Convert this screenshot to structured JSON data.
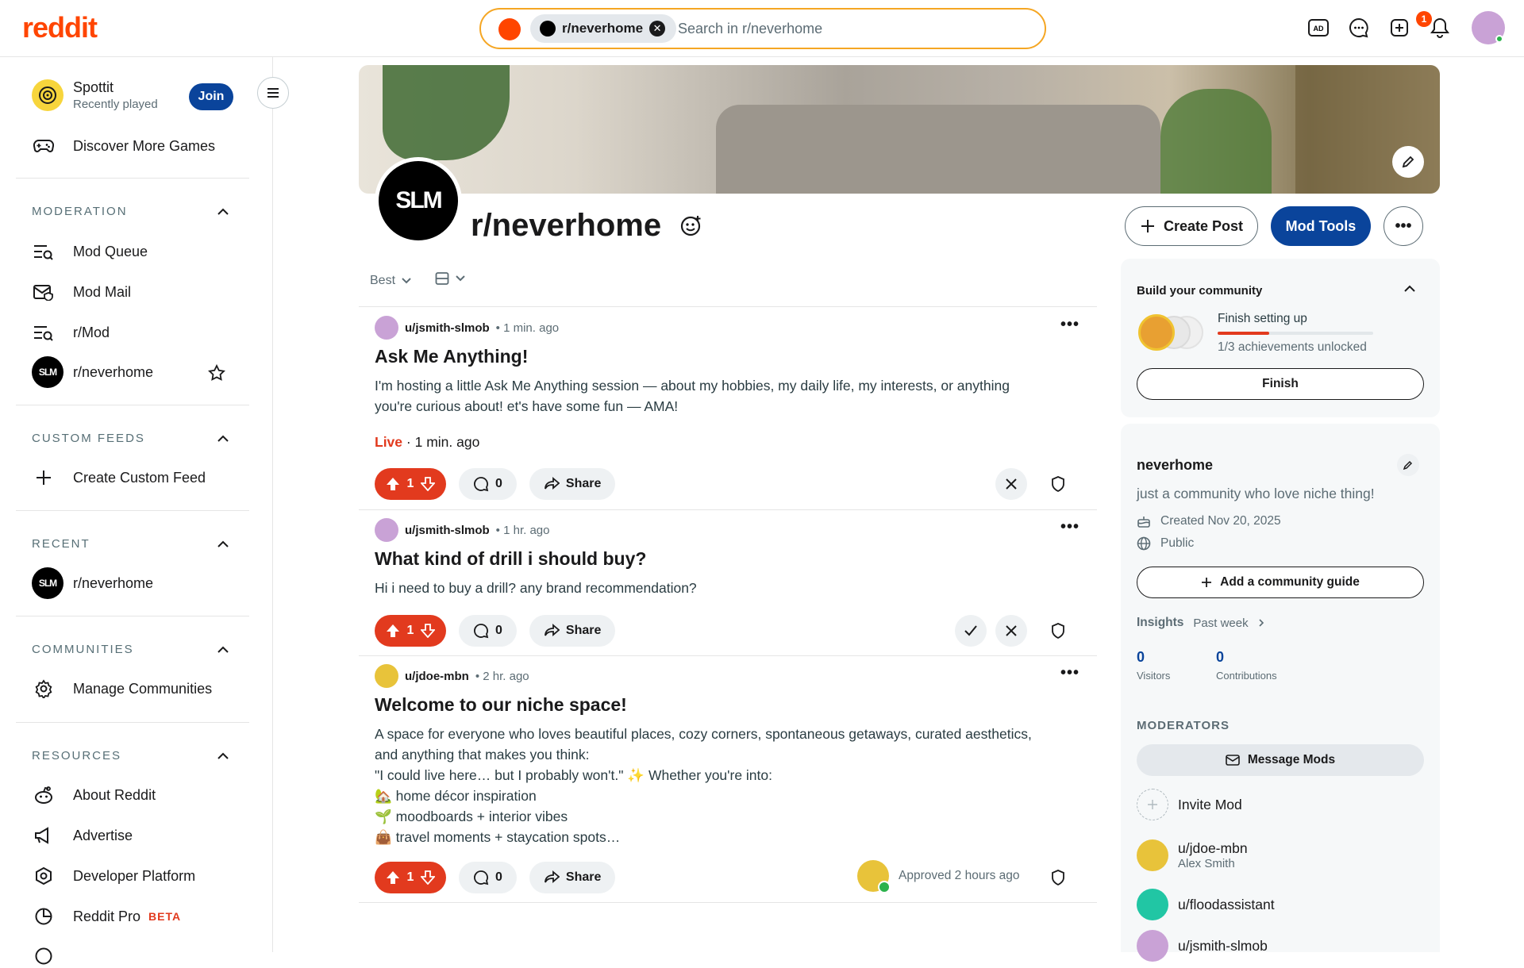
{
  "header": {
    "logo": "reddit",
    "search_chip": "r/neverhome",
    "search_placeholder": "Search in r/neverhome",
    "notification_count": "1"
  },
  "sidebar": {
    "game": {
      "name": "Spottit",
      "sub": "Recently played",
      "join": "Join"
    },
    "discover": "Discover More Games",
    "moderation": {
      "title": "MODERATION",
      "items": [
        "Mod Queue",
        "Mod Mail",
        "r/Mod",
        "r/neverhome"
      ]
    },
    "custom_feeds": {
      "title": "CUSTOM FEEDS",
      "create": "Create Custom Feed"
    },
    "recent": {
      "title": "RECENT",
      "items": [
        "r/neverhome"
      ]
    },
    "communities": {
      "title": "COMMUNITIES",
      "manage": "Manage Communities"
    },
    "resources": {
      "title": "RESOURCES",
      "items": [
        "About Reddit",
        "Advertise",
        "Developer Platform",
        "Reddit Pro"
      ],
      "pro_badge": "BETA"
    },
    "slm_text": "SLM"
  },
  "community": {
    "name": "r/neverhome",
    "create_post": "Create Post",
    "mod_tools": "Mod Tools",
    "more": "•••",
    "sort": "Best"
  },
  "posts": [
    {
      "user": "u/jsmith-slmob",
      "time": "• 1 min. ago",
      "title": "Ask Me Anything!",
      "body": [
        "I'm hosting a little Ask Me Anything session — about my hobbies, my daily life, my interests, or anything",
        "you're curious about! et's have some fun — AMA!"
      ],
      "live": "Live",
      "live_time": "· 1 min. ago",
      "votes": "1",
      "comments": "0",
      "share": "Share"
    },
    {
      "user": "u/jsmith-slmob",
      "time": "• 1 hr. ago",
      "title": "What kind of drill i should buy?",
      "body": [
        "Hi i need to buy a drill? any brand recommendation?"
      ],
      "votes": "1",
      "comments": "0",
      "share": "Share"
    },
    {
      "user": "u/jdoe-mbn",
      "time": "• 2 hr. ago",
      "title": "Welcome to our niche space!",
      "body": [
        "A space for everyone who loves beautiful places, cozy corners, spontaneous getaways, curated aesthetics,",
        "and anything that makes you think:",
        "\"I could live here… but I probably won't.\" ✨ Whether you're into:",
        "🏡 home décor inspiration",
        "🌱 moodboards + interior vibes",
        "👜 travel moments + staycation spots…"
      ],
      "votes": "1",
      "comments": "0",
      "share": "Share",
      "approved": "Approved 2 hours ago"
    }
  ],
  "right": {
    "build": {
      "title": "Build your community",
      "status": "Finish setting up",
      "progress": "1/3 achievements unlocked",
      "progress_fraction": 0.33,
      "finish": "Finish"
    },
    "about": {
      "name": "neverhome",
      "desc": "just a community who love niche thing!",
      "created": "Created Nov 20, 2025",
      "visibility": "Public",
      "guide": "Add a community guide",
      "insights": "Insights",
      "period": "Past week",
      "visitors": "0",
      "visitors_label": "Visitors",
      "contrib": "0",
      "contrib_label": "Contributions"
    },
    "moderators": {
      "title": "MODERATORS",
      "message": "Message Mods",
      "invite": "Invite Mod",
      "list": [
        {
          "name": "u/jdoe-mbn",
          "sub": "Alex Smith"
        },
        {
          "name": "u/floodassistant",
          "sub": ""
        },
        {
          "name": "u/jsmith-slmob",
          "sub": ""
        }
      ]
    }
  },
  "colors": {
    "brand": "#ff4500",
    "primary": "#0a449b",
    "upvote": "#e23a1e"
  }
}
